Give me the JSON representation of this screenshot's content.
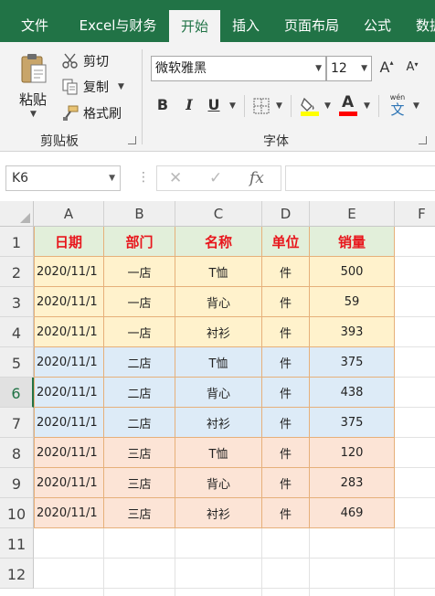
{
  "tabs": [
    {
      "label": "文件",
      "active": false
    },
    {
      "label": "Excel与财务",
      "active": false
    },
    {
      "label": "开始",
      "active": true
    },
    {
      "label": "插入",
      "active": false
    },
    {
      "label": "页面布局",
      "active": false
    },
    {
      "label": "公式",
      "active": false
    },
    {
      "label": "数据",
      "active": false
    }
  ],
  "clipboard": {
    "paste": "粘贴",
    "cut": "剪切",
    "copy": "复制",
    "format_painter": "格式刷",
    "group_label": "剪贴板"
  },
  "font": {
    "font_name": "微软雅黑",
    "font_size": "12",
    "grow_label": "A",
    "shrink_label": "A",
    "bold": "B",
    "italic": "I",
    "underline": "U",
    "font_color_label": "A",
    "phonetic_label": "wén",
    "phonetic_char": "文",
    "group_label": "字体",
    "fill_color": "#ffff00",
    "font_color": "#ff0000"
  },
  "formula_bar": {
    "name_box": "K6",
    "cancel": "✕",
    "enter": "✓",
    "fx": "fx",
    "value": ""
  },
  "sheet": {
    "columns": [
      "A",
      "B",
      "C",
      "D",
      "E",
      "F"
    ],
    "row_numbers": [
      "1",
      "2",
      "3",
      "4",
      "5",
      "6",
      "7",
      "8",
      "9",
      "10",
      "11",
      "12"
    ],
    "selected_row": "6",
    "header": [
      "日期",
      "部门",
      "名称",
      "单位",
      "销量"
    ],
    "rows": [
      [
        "2020/11/1",
        "一店",
        "T恤",
        "件",
        "500"
      ],
      [
        "2020/11/1",
        "一店",
        "背心",
        "件",
        "59"
      ],
      [
        "2020/11/1",
        "一店",
        "衬衫",
        "件",
        "393"
      ],
      [
        "2020/11/1",
        "二店",
        "T恤",
        "件",
        "375"
      ],
      [
        "2020/11/1",
        "二店",
        "背心",
        "件",
        "438"
      ],
      [
        "2020/11/1",
        "二店",
        "衬衫",
        "件",
        "375"
      ],
      [
        "2020/11/1",
        "三店",
        "T恤",
        "件",
        "120"
      ],
      [
        "2020/11/1",
        "三店",
        "背心",
        "件",
        "283"
      ],
      [
        "2020/11/1",
        "三店",
        "衬衫",
        "件",
        "469"
      ]
    ],
    "fills": {
      "header": "#e2efda",
      "store1": "#fff2cc",
      "store2": "#ddebf7",
      "store3": "#fce4d6",
      "header_text": "#e8161c",
      "border": "#e6b07a"
    }
  },
  "colors": {
    "ribbon_green": "#217346",
    "ribbon_bg": "#f3f3f3"
  }
}
